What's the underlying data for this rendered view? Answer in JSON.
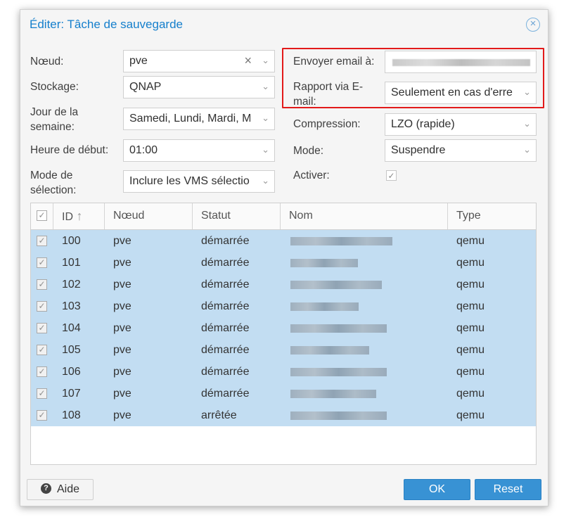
{
  "dialog": {
    "title": "Éditer: Tâche de sauvegarde",
    "close_glyph": "×"
  },
  "form_left": {
    "node": {
      "label": "Nœud:",
      "value": "pve",
      "clear_glyph": "×"
    },
    "storage": {
      "label": "Stockage:",
      "value": "QNAP"
    },
    "weekday": {
      "label_line1": "Jour de la",
      "label_line2": "semaine:",
      "value": "Samedi, Lundi, Mardi, M"
    },
    "start_time": {
      "label": "Heure de début:",
      "value": "01:00"
    },
    "selection_mode": {
      "label_line1": "Mode de",
      "label_line2": "sélection:",
      "value": "Inclure les VMS sélectio"
    }
  },
  "form_right": {
    "email": {
      "label": "Envoyer email à:"
    },
    "report": {
      "label_line1": "Rapport via E-",
      "label_line2": "mail:",
      "value": "Seulement en cas d'erre"
    },
    "compression": {
      "label": "Compression:",
      "value": "LZO (rapide)"
    },
    "mode": {
      "label": "Mode:",
      "value": "Suspendre"
    },
    "enable": {
      "label": "Activer:",
      "checked": true
    }
  },
  "grid": {
    "headers": {
      "id": "ID",
      "sort_icon": "↑",
      "node": "Nœud",
      "status": "Statut",
      "name": "Nom",
      "type": "Type"
    },
    "rows": [
      {
        "id": "100",
        "node": "pve",
        "status": "démarrée",
        "type": "qemu"
      },
      {
        "id": "101",
        "node": "pve",
        "status": "démarrée",
        "type": "qemu"
      },
      {
        "id": "102",
        "node": "pve",
        "status": "démarrée",
        "type": "qemu"
      },
      {
        "id": "103",
        "node": "pve",
        "status": "démarrée",
        "type": "qemu"
      },
      {
        "id": "104",
        "node": "pve",
        "status": "démarrée",
        "type": "qemu"
      },
      {
        "id": "105",
        "node": "pve",
        "status": "démarrée",
        "type": "qemu"
      },
      {
        "id": "106",
        "node": "pve",
        "status": "démarrée",
        "type": "qemu"
      },
      {
        "id": "107",
        "node": "pve",
        "status": "démarrée",
        "type": "qemu"
      },
      {
        "id": "108",
        "node": "pve",
        "status": "arrêtée",
        "type": "qemu"
      }
    ]
  },
  "footer": {
    "help_label": "Aide",
    "help_icon": "?",
    "ok_label": "OK",
    "reset_label": "Reset"
  },
  "colors": {
    "title": "#157fcc",
    "row_selected": "#c2ddf2",
    "button_primary": "#3892d4",
    "highlight_box": "#e21a1a"
  },
  "icons": {
    "dropdown": "chevron-down-icon",
    "checkbox": "checkmark-icon",
    "close": "close-circle-icon",
    "help": "question-circle-icon"
  }
}
